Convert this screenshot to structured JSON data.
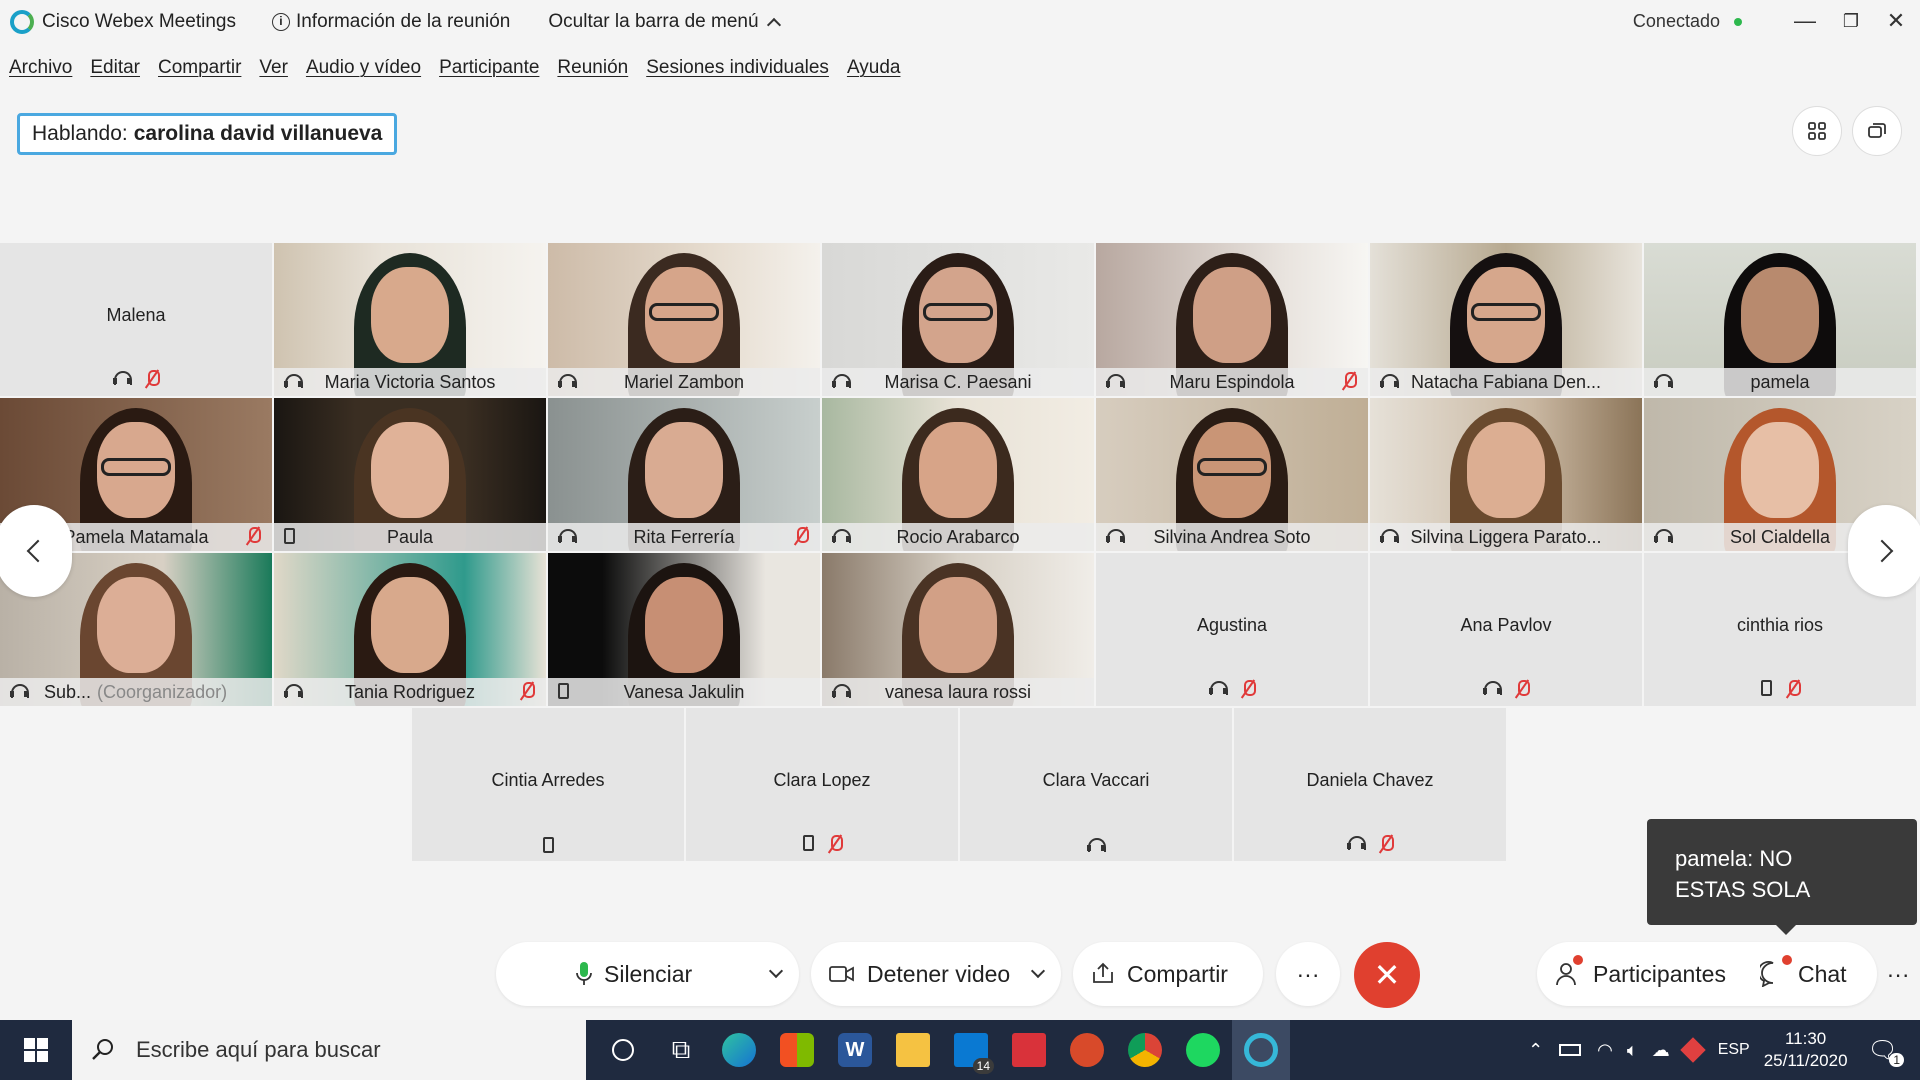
{
  "titlebar": {
    "app_title": "Cisco Webex Meetings",
    "meeting_info": "Información de la reunión",
    "hide_menu": "Ocultar la barra de menú",
    "status": "Conectado",
    "status_color": "#2db84d"
  },
  "menu": [
    "Archivo",
    "Editar",
    "Compartir",
    "Ver",
    "Audio y vídeo",
    "Participante",
    "Reunión",
    "Sesiones individuales",
    "Ayuda"
  ],
  "speaking": {
    "prefix": "Hablando:",
    "name": "carolina david villanueva"
  },
  "participants_video": [
    {
      "name": "Maria Victoria Santos",
      "audio": "headphone",
      "muted": false
    },
    {
      "name": "Mariel Zambon",
      "audio": "headphone",
      "muted": false
    },
    {
      "name": "Marisa C. Paesani",
      "audio": "headphone",
      "muted": false
    },
    {
      "name": "Maru Espindola",
      "audio": "headphone",
      "muted": true
    },
    {
      "name": "Natacha Fabiana Den...",
      "audio": "headphone",
      "muted": false
    },
    {
      "name": "pamela",
      "audio": "headphone",
      "muted": false
    },
    {
      "name": "Pamela Matamala",
      "audio": "headphone",
      "muted": true
    },
    {
      "name": "Paula",
      "audio": "phone",
      "muted": false
    },
    {
      "name": "Rita Ferrería",
      "audio": "headphone",
      "muted": true
    },
    {
      "name": "Rocio Arabarco",
      "audio": "headphone",
      "muted": false
    },
    {
      "name": "Silvina Andrea Soto",
      "audio": "headphone",
      "muted": false
    },
    {
      "name": "Silvina Liggera Parato...",
      "audio": "headphone",
      "muted": false
    },
    {
      "name": "Sol Cialdella",
      "audio": "headphone",
      "muted": false
    },
    {
      "name": "Sub...",
      "role": "(Coorganizador)",
      "audio": "headphone",
      "muted": false
    },
    {
      "name": "Tania Rodriguez",
      "audio": "headphone",
      "muted": true
    },
    {
      "name": "Vanesa Jakulin",
      "audio": "phone",
      "muted": false
    },
    {
      "name": "vanesa laura rossi",
      "audio": "headphone",
      "muted": false
    }
  ],
  "participants_novideo": [
    {
      "name": "Malena",
      "audio": "headphone",
      "muted": true
    },
    {
      "name": "Agustina",
      "audio": "headphone",
      "muted": true
    },
    {
      "name": "Ana Pavlov",
      "audio": "headphone",
      "muted": true
    },
    {
      "name": "cinthia rios",
      "audio": "phone",
      "muted": true
    },
    {
      "name": "Cintia Arredes",
      "audio": "phone",
      "muted": false
    },
    {
      "name": "Clara Lopez",
      "audio": "phone",
      "muted": true
    },
    {
      "name": "Clara Vaccari",
      "audio": "headphone",
      "muted": false
    },
    {
      "name": "Daniela Chavez",
      "audio": "headphone",
      "muted": true
    }
  ],
  "toast": {
    "line1": "pamela: NO",
    "line2": "ESTAS SOLA"
  },
  "controls": {
    "mute": "Silenciar",
    "stop_video": "Detener video",
    "share": "Compartir",
    "more": "···",
    "participants": "Participantes",
    "chat": "Chat",
    "end_color": "#e0402f"
  },
  "taskbar": {
    "search_placeholder": "Escribe aquí para buscar",
    "mail_badge": "14",
    "language": "ESP",
    "time": "11:30",
    "date": "25/11/2020",
    "notifications": "1"
  }
}
